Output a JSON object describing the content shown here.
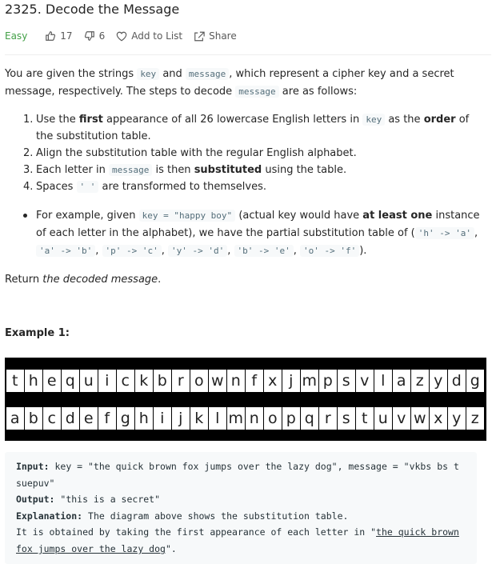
{
  "problem": {
    "title": "2325. Decode the Message",
    "difficulty": "Easy",
    "likes": "17",
    "dislikes": "6",
    "add_to_list": "Add to List",
    "share": "Share"
  },
  "description": {
    "intro_1": "You are given the strings ",
    "intro_key": "key",
    "intro_2": " and ",
    "intro_message": "message",
    "intro_3": ", which represent a cipher key and a secret message, respectively. The steps to decode ",
    "intro_message_2": "message",
    "intro_4": " are as follows:",
    "steps": [
      {
        "num": "1.",
        "a": "Use the ",
        "b": "first",
        "c": " appearance of all 26 lowercase English letters in ",
        "code": "key",
        "d": " as the ",
        "e": "order",
        "f": " of the substitution table."
      },
      {
        "num": "2.",
        "text": "Align the substitution table with the regular English alphabet."
      },
      {
        "num": "3.",
        "a": "Each letter in ",
        "code": "message",
        "b": " is then ",
        "c": "substituted",
        "d": " using the table."
      },
      {
        "num": "4.",
        "a": "Spaces ",
        "code": "' '",
        "b": " are transformed to themselves."
      }
    ],
    "example_bullet": {
      "a": "For example, given ",
      "code": "key = \"happy boy\"",
      "b": " (actual key would have ",
      "c": "at least one",
      "d": " instance of each letter in the alphabet), we have the partial substitution table of (",
      "codes": [
        "'h' -> 'a'",
        "'a' -> 'b'",
        "'p' -> 'c'",
        "'y' -> 'd'",
        "'b' -> 'e'",
        "'o' -> 'f'"
      ],
      "e": ")."
    },
    "return_a": "Return ",
    "return_b": "the decoded message",
    "return_c": "."
  },
  "example": {
    "heading": "Example 1:",
    "top_row": [
      "t",
      "h",
      "e",
      "q",
      "u",
      "i",
      "c",
      "k",
      "b",
      "r",
      "o",
      "w",
      "n",
      "f",
      "x",
      "j",
      "m",
      "p",
      "s",
      "v",
      "l",
      "a",
      "z",
      "y",
      "d",
      "g"
    ],
    "bottom_row": [
      "a",
      "b",
      "c",
      "d",
      "e",
      "f",
      "g",
      "h",
      "i",
      "j",
      "k",
      "l",
      "m",
      "n",
      "o",
      "p",
      "q",
      "r",
      "s",
      "t",
      "u",
      "v",
      "w",
      "x",
      "y",
      "z"
    ],
    "input_label": "Input:",
    "input_line1": " key = \"the quick brown fox jumps over the lazy dog\", message = \"vkbs bs t",
    "input_line2": "suepuv\"",
    "output_label": "Output:",
    "output_value": " \"this is a secret\"",
    "explanation_label": "Explanation:",
    "explanation_value": " The diagram above shows the substitution table.",
    "explanation_line2": "It is obtained by taking the first appearance of each letter in \"",
    "explanation_phrase1": "the quick brown",
    "explanation_phrase2": "fox jumps over the lazy dog",
    "explanation_end": "\"."
  }
}
